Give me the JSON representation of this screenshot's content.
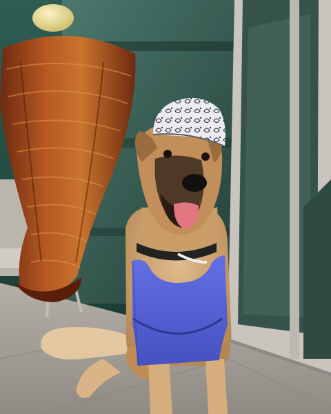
{
  "scene": {
    "subjects": [
      "dog",
      "al-pastor-trompo",
      "bandana-cap",
      "blue-apron",
      "glass-door",
      "tile-floor"
    ]
  },
  "colors": {
    "wall": "#1f4a3f",
    "glass": "#3d6a5e",
    "frame": "#b8b4ad",
    "floor": "#a7a39b",
    "meat_dark": "#6e2a10",
    "meat_mid": "#9a4a1c",
    "meat_light": "#c9742e",
    "onion": "#e8d99a",
    "dog_tan": "#c89a68",
    "dog_dark": "#2a211b",
    "apron": "#5a66d8",
    "apron_dark": "#3e48b0",
    "tongue": "#e0707a",
    "cap": "#e6e6ea"
  }
}
